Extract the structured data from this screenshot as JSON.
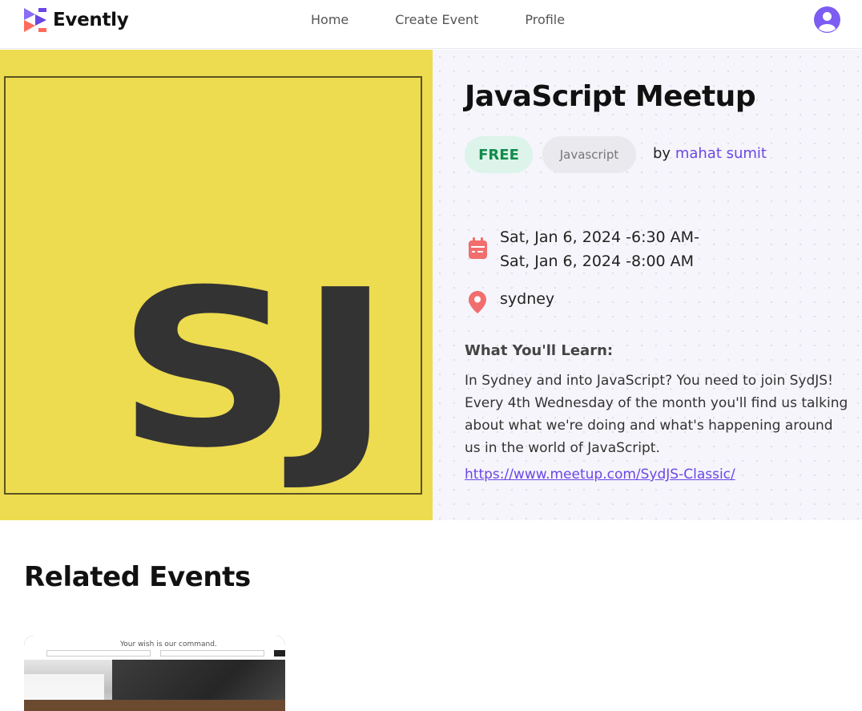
{
  "app": {
    "name": "Evently"
  },
  "nav": {
    "items": [
      "Home",
      "Create Event",
      "Profile"
    ]
  },
  "event": {
    "title": "JavaScript Meetup",
    "price_badge": "FREE",
    "category": "Javascript",
    "by_prefix": "by",
    "organizer": "mahat sumit",
    "date_line1": "Sat, Jan 6, 2024 -6:30 AM-",
    "date_line2": "Sat, Jan 6, 2024 -8:00 AM",
    "location": "sydney",
    "learn_heading": "What You'll Learn:",
    "description": "In Sydney and into JavaScript? You need to join SydJS! Every 4th Wednesday of the month you'll find us talking about what we're doing and what's happening around us in the world of JavaScript.",
    "url": "https://www.meetup.com/SydJS-Classic/",
    "image_letters": "SJ"
  },
  "related": {
    "heading": "Related Events",
    "cards": [
      {
        "image_caption": "Your wish is our command."
      }
    ]
  },
  "colors": {
    "accent": "#6b46e6",
    "free_badge_bg": "#dcf4ea",
    "free_badge_text": "#128a4c",
    "hero_image_bg": "#eddb50",
    "icon_red": "#f26d6d"
  },
  "icons": [
    "evently-logo-icon",
    "user-avatar-icon",
    "calendar-icon",
    "location-pin-icon"
  ]
}
